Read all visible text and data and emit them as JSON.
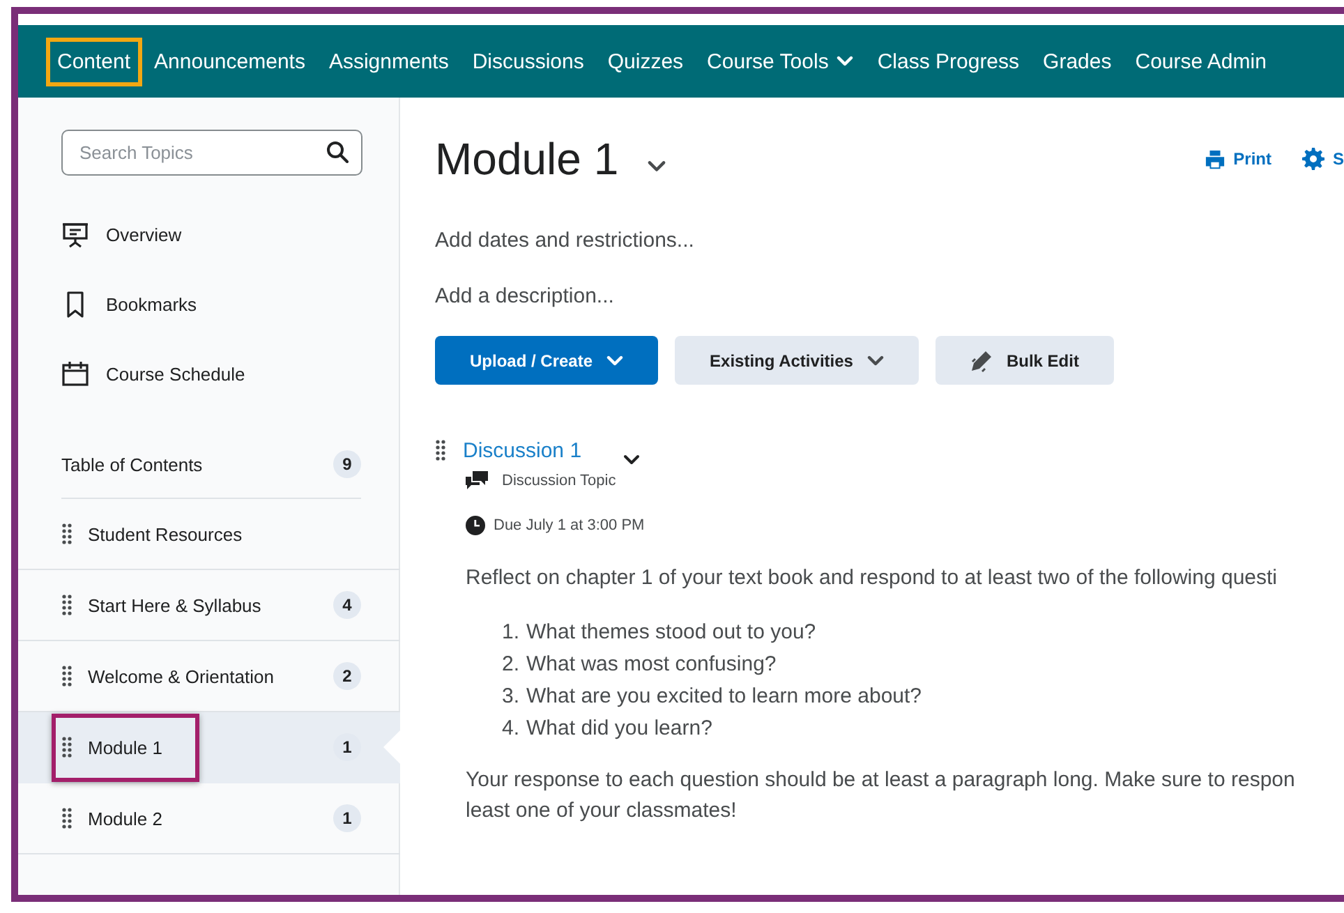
{
  "nav": {
    "items": [
      {
        "label": "Content",
        "highlighted": true,
        "kind": "link"
      },
      {
        "label": "Announcements",
        "highlighted": false,
        "kind": "link"
      },
      {
        "label": "Assignments",
        "highlighted": false,
        "kind": "link"
      },
      {
        "label": "Discussions",
        "highlighted": false,
        "kind": "link"
      },
      {
        "label": "Quizzes",
        "highlighted": false,
        "kind": "link"
      },
      {
        "label": "Course Tools",
        "highlighted": false,
        "kind": "menu"
      },
      {
        "label": "Class Progress",
        "highlighted": false,
        "kind": "link"
      },
      {
        "label": "Grades",
        "highlighted": false,
        "kind": "link"
      },
      {
        "label": "Course Admin",
        "highlighted": false,
        "kind": "link"
      }
    ]
  },
  "sidebar": {
    "search": {
      "placeholder": "Search Topics"
    },
    "links": [
      {
        "label": "Overview"
      },
      {
        "label": "Bookmarks"
      },
      {
        "label": "Course Schedule"
      }
    ],
    "toc": {
      "title": "Table of Contents",
      "count": "9",
      "items": [
        {
          "label": "Student Resources",
          "selected": false,
          "highlighted": false
        },
        {
          "label": "Start Here & Syllabus",
          "count": "4",
          "selected": false,
          "highlighted": false
        },
        {
          "label": "Welcome & Orientation",
          "count": "2",
          "selected": false,
          "highlighted": false
        },
        {
          "label": "Module 1",
          "count": "1",
          "selected": true,
          "highlighted": true
        },
        {
          "label": "Module 2",
          "count": "1",
          "selected": false,
          "highlighted": false
        }
      ]
    }
  },
  "main": {
    "title": "Module 1",
    "actions": [
      {
        "label": "Print",
        "kind": "print"
      },
      {
        "label": "S",
        "kind": "settings"
      }
    ],
    "links": [
      "Add dates and restrictions...",
      "Add a description..."
    ],
    "buttons": [
      {
        "label": "Upload / Create",
        "kind": "primary"
      },
      {
        "label": "Existing Activities",
        "kind": "secondary"
      },
      {
        "label": "Bulk Edit",
        "kind": "edit"
      }
    ],
    "topic": {
      "title": "Discussion 1",
      "type": "Discussion Topic",
      "due": "Due July 1 at 3:00 PM",
      "intro": "Reflect on chapter 1 of your text book and respond to at least two of the following questi",
      "questions": [
        {
          "number": "1.",
          "text": "What themes stood out to you?"
        },
        {
          "number": "2.",
          "text": "What was most confusing?"
        },
        {
          "number": "3.",
          "text": "What are you excited to learn more about?"
        },
        {
          "number": "4.",
          "text": "What did you learn?"
        }
      ],
      "closing": [
        "Your response to each question should be at least a paragraph long. Make sure to respon",
        "least one of your classmates!"
      ]
    }
  }
}
